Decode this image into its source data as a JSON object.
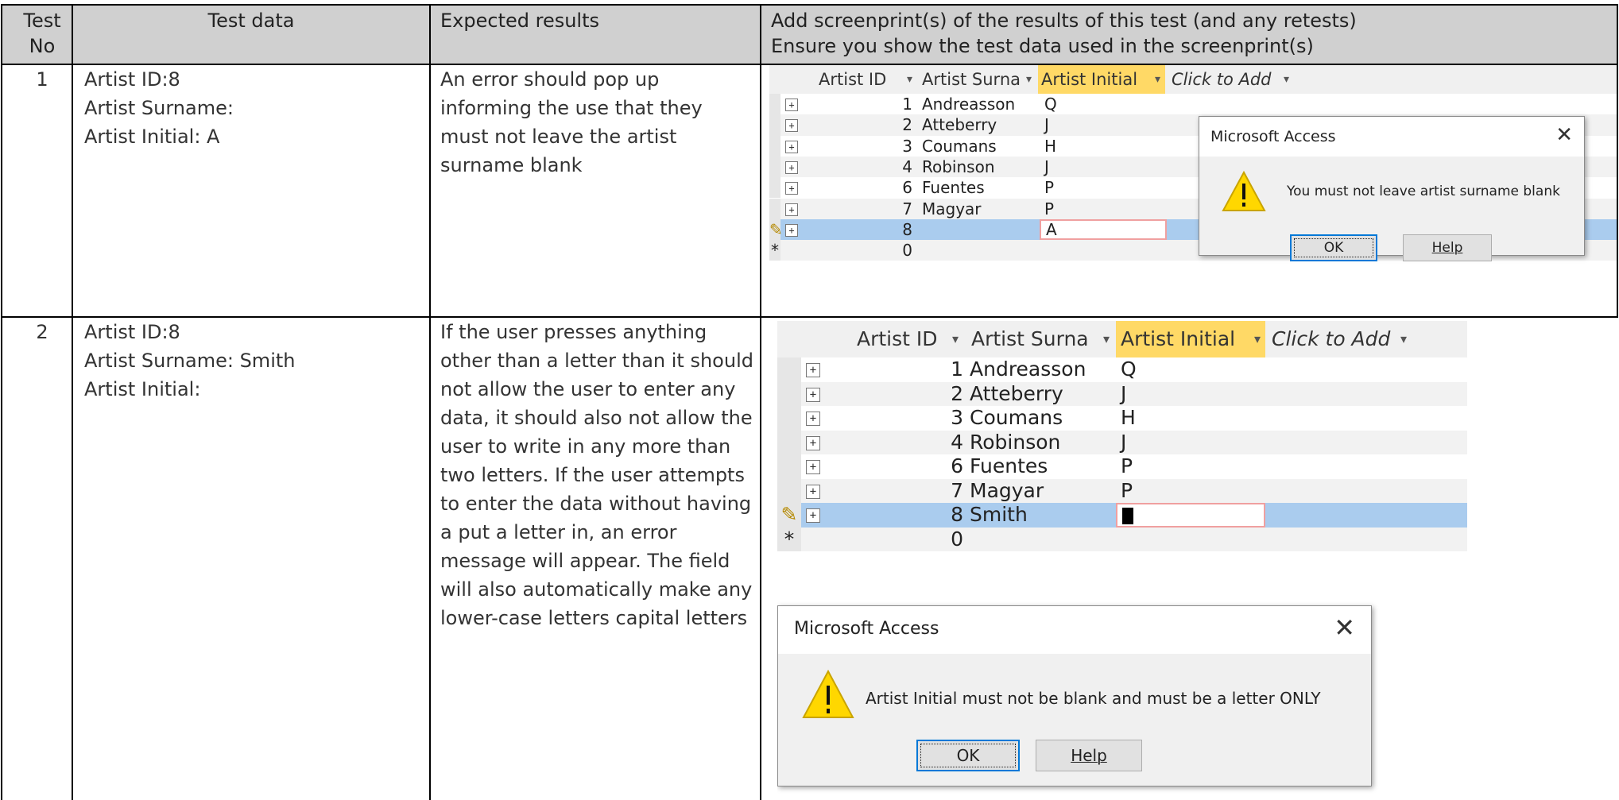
{
  "table": {
    "headers": {
      "test_no": "Test\nNo",
      "test_data": "Test data",
      "expected_results": "Expected results",
      "screenprint": "Add screenprint(s) of the results of this test (and any retests)\nEnsure you show the test data used in the screenprint(s)"
    },
    "rows": [
      {
        "no": "1",
        "test_data": "Artist ID:8\nArtist Surname:\nArtist Initial: A",
        "expected": "An error should pop up\ninforming the use that they\nmust not leave the artist\nsurname blank"
      },
      {
        "no": "2",
        "test_data": "Artist ID:8\nArtist Surname: Smith\nArtist Initial:",
        "expected": "If the user presses anything\nother than a letter than it should\nnot allow the user to enter any\ndata, it should also not allow the\nuser to write in any more than\ntwo letters. If the user attempts\nto enter the data without having\na put a letter in, an error\nmessage will appear. The field\nwill also automatically make any\nlower-case letters capital letters"
      }
    ]
  },
  "access": {
    "columns": [
      "Artist ID",
      "Artist Surna",
      "Artist Initial",
      "Click to Add"
    ],
    "shot1_rows": [
      {
        "id": "1",
        "surname": "Andreasson",
        "initial": "Q"
      },
      {
        "id": "2",
        "surname": "Atteberry",
        "initial": "J"
      },
      {
        "id": "3",
        "surname": "Coumans",
        "initial": "H"
      },
      {
        "id": "4",
        "surname": "Robinson",
        "initial": "J"
      },
      {
        "id": "6",
        "surname": "Fuentes",
        "initial": "P"
      },
      {
        "id": "7",
        "surname": "Magyar",
        "initial": "P"
      },
      {
        "id": "8",
        "surname": "",
        "initial": "A"
      },
      {
        "id": "0",
        "surname": "",
        "initial": ""
      }
    ],
    "shot2_rows": [
      {
        "id": "1",
        "surname": "Andreasson",
        "initial": "Q"
      },
      {
        "id": "2",
        "surname": "Atteberry",
        "initial": "J"
      },
      {
        "id": "3",
        "surname": "Coumans",
        "initial": "H"
      },
      {
        "id": "4",
        "surname": "Robinson",
        "initial": "J"
      },
      {
        "id": "6",
        "surname": "Fuentes",
        "initial": "P"
      },
      {
        "id": "7",
        "surname": "Magyar",
        "initial": "P"
      },
      {
        "id": "8",
        "surname": "Smith",
        "initial": ""
      },
      {
        "id": "0",
        "surname": "",
        "initial": ""
      }
    ],
    "expander_symbol": "+",
    "edit_symbol": "✎",
    "new_row_symbol": "*",
    "dropdown_symbol": "▾"
  },
  "dialog1": {
    "title": "Microsoft Access",
    "close": "✕",
    "message": "You must not leave artist surname blank",
    "ok": "OK",
    "help": "Help",
    "icon": "warning-icon"
  },
  "dialog2": {
    "title": "Microsoft Access",
    "close": "✕",
    "message": "Artist Initial must not be blank and must be a letter ONLY",
    "ok": "OK",
    "help": "Help",
    "icon": "warning-icon"
  },
  "colors": {
    "header_bg": "#d0d0d0",
    "selected_row": "#aaccee",
    "selected_column": "#ffd966",
    "warning_yellow": "#ffd700",
    "ok_focus": "#0078d7"
  }
}
